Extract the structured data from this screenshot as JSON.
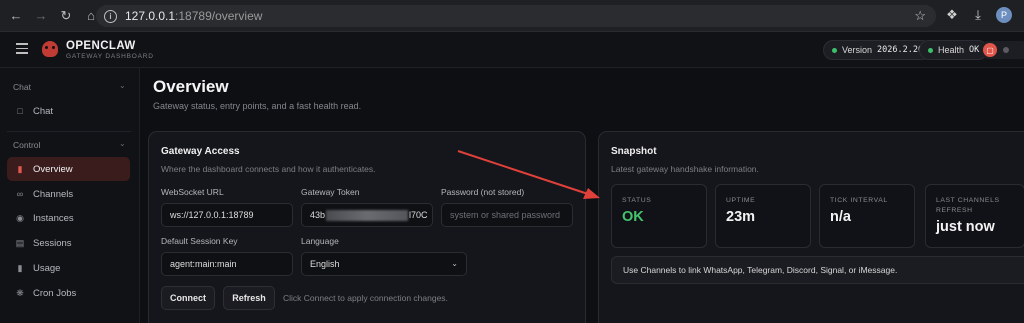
{
  "browser": {
    "url_host": "127.0.0.1",
    "url_path": ":18789/overview",
    "profile_initial": "P"
  },
  "header": {
    "brand": "OPENCLAW",
    "brand_sub": "GATEWAY DASHBOARD",
    "version_label": "Version",
    "version_value": "2026.2.26",
    "health_label": "Health",
    "health_value": "OK"
  },
  "sidebar": {
    "sections": [
      {
        "label": "Chat",
        "items": [
          {
            "label": "Chat",
            "icon": "chat-bubble-icon"
          }
        ]
      },
      {
        "label": "Control",
        "items": [
          {
            "label": "Overview",
            "icon": "bar-chart-icon",
            "active": true
          },
          {
            "label": "Channels",
            "icon": "link-icon"
          },
          {
            "label": "Instances",
            "icon": "radio-icon"
          },
          {
            "label": "Sessions",
            "icon": "document-icon"
          },
          {
            "label": "Usage",
            "icon": "bar-chart-icon"
          },
          {
            "label": "Cron Jobs",
            "icon": "loader-icon"
          }
        ]
      }
    ]
  },
  "main": {
    "title": "Overview",
    "subtitle": "Gateway status, entry points, and a fast health read."
  },
  "gateway": {
    "title": "Gateway Access",
    "subtitle": "Where the dashboard connects and how it authenticates.",
    "ws_label": "WebSocket URL",
    "ws_value": "ws://127.0.0.1:18789",
    "token_label": "Gateway Token",
    "token_prefix": "43b",
    "token_suffix": "l70C",
    "password_label": "Password (not stored)",
    "password_placeholder": "system or shared password",
    "session_label": "Default Session Key",
    "session_value": "agent:main:main",
    "language_label": "Language",
    "language_value": "English",
    "connect_label": "Connect",
    "refresh_label": "Refresh",
    "hint": "Click Connect to apply connection changes."
  },
  "snapshot": {
    "title": "Snapshot",
    "subtitle": "Latest gateway handshake information.",
    "stats": [
      {
        "label": "STATUS",
        "value": "OK"
      },
      {
        "label": "UPTIME",
        "value": "23m"
      },
      {
        "label": "TICK INTERVAL",
        "value": "n/a"
      },
      {
        "label": "LAST CHANNELS REFRESH",
        "value": "just now"
      }
    ],
    "notice": "Use Channels to link WhatsApp, Telegram, Discord, Signal, or iMessage."
  },
  "colors": {
    "accent": "#e4574f",
    "ok": "#43c46d",
    "annotation_arrow": "#e0403a"
  }
}
